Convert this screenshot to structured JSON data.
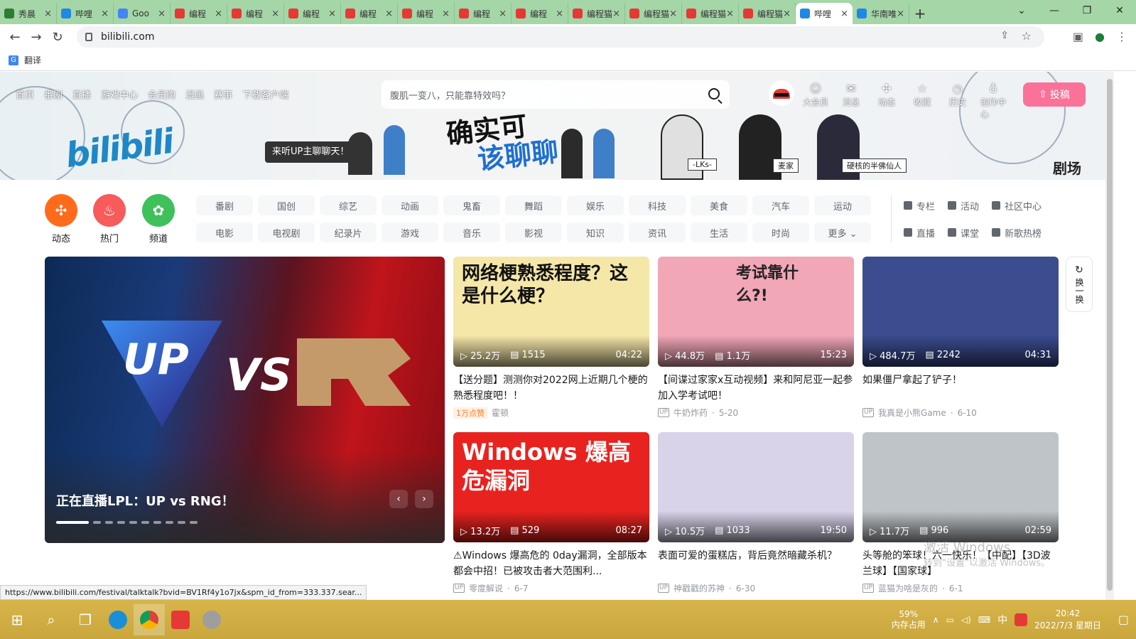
{
  "browser": {
    "tabs": [
      {
        "label": "秀晨",
        "color": "#2e7d32"
      },
      {
        "label": "哔哩",
        "color": "#1e88e5"
      },
      {
        "label": "Goo",
        "color": "#4285f4"
      },
      {
        "label": "编程",
        "color": "#e53935"
      },
      {
        "label": "编程",
        "color": "#e53935"
      },
      {
        "label": "编程",
        "color": "#e53935"
      },
      {
        "label": "编程",
        "color": "#e53935"
      },
      {
        "label": "编程",
        "color": "#e53935"
      },
      {
        "label": "编程",
        "color": "#e53935"
      },
      {
        "label": "编程",
        "color": "#e53935"
      },
      {
        "label": "编程猫",
        "color": "#e53935"
      },
      {
        "label": "编程猫",
        "color": "#e53935"
      },
      {
        "label": "编程猫",
        "color": "#e53935"
      },
      {
        "label": "编程猫",
        "color": "#e53935"
      },
      {
        "label": "哔哩",
        "color": "#1e88e5"
      },
      {
        "label": "华南唯",
        "color": "#1e88e5"
      }
    ],
    "close_glyph": "×",
    "add_glyph": "+",
    "url": "bilibili.com",
    "bookmark": "翻译",
    "status_url": "https://www.bilibili.com/festival/talktalk?bvid=BV1Rf4y1o7jx&spm_id_from=333.337.sear..."
  },
  "header": {
    "nav": [
      "首页",
      "番剧",
      "直播",
      "游戏中心",
      "会员购",
      "漫画",
      "赛事",
      "下载客户端"
    ],
    "search_placeholder": "腹肌一变八，只能靠特效吗？",
    "right_items": [
      {
        "label": "大会员",
        "icon": "vip-icon",
        "glyph": "☺"
      },
      {
        "label": "消息",
        "icon": "mail-icon",
        "glyph": "✉"
      },
      {
        "label": "动态",
        "icon": "wind-icon",
        "glyph": "✣"
      },
      {
        "label": "收藏",
        "icon": "star-icon",
        "glyph": "☆"
      },
      {
        "label": "历史",
        "icon": "clock-icon",
        "glyph": "◷"
      },
      {
        "label": "创作中心",
        "icon": "bulb-icon",
        "glyph": "♁"
      }
    ],
    "upload_label": "投稿",
    "accent": "#fb7299"
  },
  "banner": {
    "logo": "bilibili",
    "tip": "来听UP主聊聊天！",
    "title_line1": "确实可",
    "title_line2": "该聊聊",
    "names": [
      "-LKs-",
      "麦家",
      "硬核的半佛仙人"
    ],
    "brand": "剧场"
  },
  "channels": {
    "circles": [
      {
        "label": "动态",
        "color": "#ff6b1a",
        "glyph": "✣"
      },
      {
        "label": "热门",
        "color": "#f75b5b",
        "glyph": "♨"
      },
      {
        "label": "频道",
        "color": "#3ec05a",
        "glyph": "✿"
      }
    ],
    "tags": [
      "番剧",
      "国创",
      "综艺",
      "动画",
      "鬼畜",
      "舞蹈",
      "娱乐",
      "科技",
      "美食",
      "汽车",
      "运动",
      "电影",
      "电视剧",
      "纪录片",
      "游戏",
      "音乐",
      "影视",
      "知识",
      "资讯",
      "生活",
      "时尚",
      "更多 ⌄"
    ],
    "side": [
      "专栏",
      "活动",
      "社区中心",
      "直播",
      "课堂",
      "新歌热榜"
    ]
  },
  "carousel": {
    "title": "正在直播LPL：UP vs RNG！",
    "logo_left": "UP",
    "vs": "VS",
    "prev": "‹",
    "next": "›"
  },
  "cards": [
    {
      "views": "25.2万",
      "danmaku": "1515",
      "duration": "04:22",
      "title": "【送分题】测测你对2022网上近期几个梗的熟悉程度吧！！",
      "badge": "1万点赞",
      "author": "霍顿",
      "date": "",
      "overlay": "网络梗熟悉程度？这是什么梗？",
      "bg": "#f5e7a8"
    },
    {
      "views": "44.8万",
      "danmaku": "1.1万",
      "duration": "15:23",
      "title": "【间谍过家家x互动视频】来和阿尼亚一起参加入学考试吧！",
      "badge": "",
      "author": "牛奶炸药",
      "date": "5-20",
      "overlay": "考试靠什么?!",
      "bg": "#f2a7b7"
    },
    {
      "views": "484.7万",
      "danmaku": "2242",
      "duration": "04:31",
      "title": "如果僵尸拿起了铲子！",
      "badge": "",
      "author": "我真是小熊Game",
      "date": "6-10",
      "overlay": "",
      "bg": "#3b4c8f"
    },
    {
      "views": "13.2万",
      "danmaku": "529",
      "duration": "08:27",
      "title": "⚠Windows 爆高危的 0day漏洞，全部版本都会中招！已被攻击者大范围利...",
      "badge": "",
      "author": "零度解说",
      "date": "6-7",
      "overlay": "Windows 爆高危漏洞",
      "bg": "#e8231f"
    },
    {
      "views": "10.5万",
      "danmaku": "1033",
      "duration": "19:50",
      "title": "表面可爱的蛋糕店，背后竟然暗藏杀机？",
      "badge": "",
      "author": "神戳戳的苏神",
      "date": "6-30",
      "overlay": "",
      "bg": "#d9d3ea"
    },
    {
      "views": "11.7万",
      "danmaku": "996",
      "duration": "02:59",
      "title": "头等舱的笨球！六一快乐！【中配】【3D波兰球】【国家球】",
      "badge": "",
      "author": "蓝猫为啥是灰的",
      "date": "6-1",
      "overlay": "",
      "bg": "#bfc4c8"
    }
  ],
  "refresh_label": "换一换",
  "watermark": {
    "line1": "激活 Windows",
    "line2": "转到\"设置\"以激活 Windows。"
  },
  "taskbar": {
    "mem_value": "59%",
    "mem_label": "内存占用",
    "ime": "中",
    "time": "20:42",
    "date": "2022/7/3 星期日"
  }
}
